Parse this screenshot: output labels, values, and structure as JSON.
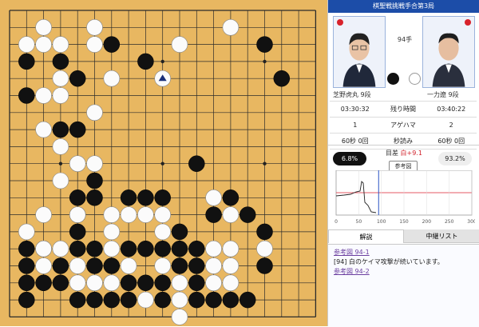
{
  "header": {
    "title": "棋聖戦挑戦手合第3局"
  },
  "players": {
    "black": {
      "name": "芝野虎丸 9段",
      "time": "03:30:32",
      "agehama": "1",
      "byoyomi": "60秒 0回"
    },
    "white": {
      "name": "一力遼 9段",
      "time": "03:40:22",
      "agehama": "2",
      "byoyomi": "60秒 0回"
    }
  },
  "move_label": "94手",
  "labels": {
    "time_left": "残り時間",
    "agehama": "アゲハマ",
    "byoyomi": "秒読み"
  },
  "eval": {
    "black_pct": "6.8%",
    "white_pct": "93.2%",
    "diff_prefix": "目差",
    "diff_value": "白+9.1",
    "ref_button": "参考図"
  },
  "graph": {
    "x_ticks": [
      "0",
      "50",
      "100",
      "150",
      "200",
      "250",
      "300"
    ],
    "current_move": 94
  },
  "tabs": {
    "commentary": "解説",
    "record_list": "中継リスト"
  },
  "commentary": {
    "link1": "参考図 94-1",
    "text": "[94] 白のケイマ攻撃が続いています。",
    "link2": "参考図 94-2"
  },
  "board": {
    "size": 19,
    "last_move": [
      9,
      4
    ],
    "black": [
      [
        6,
        2
      ],
      [
        15,
        2
      ],
      [
        1,
        3
      ],
      [
        3,
        3
      ],
      [
        8,
        3
      ],
      [
        4,
        4
      ],
      [
        16,
        4
      ],
      [
        1,
        5
      ],
      [
        3,
        7
      ],
      [
        4,
        7
      ],
      [
        4,
        11
      ],
      [
        11,
        9
      ],
      [
        5,
        10
      ],
      [
        7,
        11
      ],
      [
        8,
        11
      ],
      [
        9,
        11
      ],
      [
        5,
        11
      ],
      [
        13,
        11
      ],
      [
        12,
        12
      ],
      [
        14,
        12
      ],
      [
        4,
        12
      ],
      [
        10,
        13
      ],
      [
        15,
        13
      ],
      [
        4,
        13
      ],
      [
        1,
        14
      ],
      [
        2,
        14
      ],
      [
        4,
        14
      ],
      [
        5,
        14
      ],
      [
        7,
        14
      ],
      [
        8,
        14
      ],
      [
        9,
        14
      ],
      [
        10,
        14
      ],
      [
        11,
        14
      ],
      [
        1,
        15
      ],
      [
        3,
        15
      ],
      [
        5,
        15
      ],
      [
        6,
        15
      ],
      [
        10,
        15
      ],
      [
        11,
        15
      ],
      [
        15,
        15
      ],
      [
        1,
        16
      ],
      [
        2,
        16
      ],
      [
        3,
        16
      ],
      [
        7,
        16
      ],
      [
        8,
        16
      ],
      [
        9,
        16
      ],
      [
        11,
        16
      ],
      [
        1,
        17
      ],
      [
        4,
        17
      ],
      [
        5,
        17
      ],
      [
        6,
        17
      ],
      [
        7,
        17
      ],
      [
        9,
        17
      ],
      [
        11,
        17
      ],
      [
        12,
        17
      ],
      [
        13,
        17
      ],
      [
        14,
        17
      ]
    ],
    "white": [
      [
        2,
        1
      ],
      [
        5,
        1
      ],
      [
        13,
        1
      ],
      [
        1,
        2
      ],
      [
        2,
        2
      ],
      [
        3,
        2
      ],
      [
        5,
        2
      ],
      [
        10,
        2
      ],
      [
        3,
        4
      ],
      [
        6,
        4
      ],
      [
        2,
        5
      ],
      [
        3,
        5
      ],
      [
        5,
        6
      ],
      [
        2,
        7
      ],
      [
        3,
        8
      ],
      [
        4,
        9
      ],
      [
        5,
        9
      ],
      [
        3,
        10
      ],
      [
        2,
        12
      ],
      [
        6,
        12
      ],
      [
        7,
        12
      ],
      [
        8,
        12
      ],
      [
        9,
        12
      ],
      [
        12,
        11
      ],
      [
        13,
        12
      ],
      [
        4,
        12
      ],
      [
        1,
        13
      ],
      [
        6,
        13
      ],
      [
        9,
        13
      ],
      [
        2,
        15
      ],
      [
        4,
        15
      ],
      [
        7,
        15
      ],
      [
        9,
        15
      ],
      [
        13,
        14
      ],
      [
        12,
        14
      ],
      [
        2,
        14
      ],
      [
        3,
        14
      ],
      [
        6,
        14
      ],
      [
        6,
        16
      ],
      [
        12,
        15
      ],
      [
        13,
        15
      ],
      [
        4,
        16
      ],
      [
        5,
        16
      ],
      [
        10,
        16
      ],
      [
        12,
        16
      ],
      [
        15,
        14
      ],
      [
        8,
        17
      ],
      [
        10,
        17
      ],
      [
        13,
        16
      ],
      [
        10,
        18
      ]
    ]
  }
}
